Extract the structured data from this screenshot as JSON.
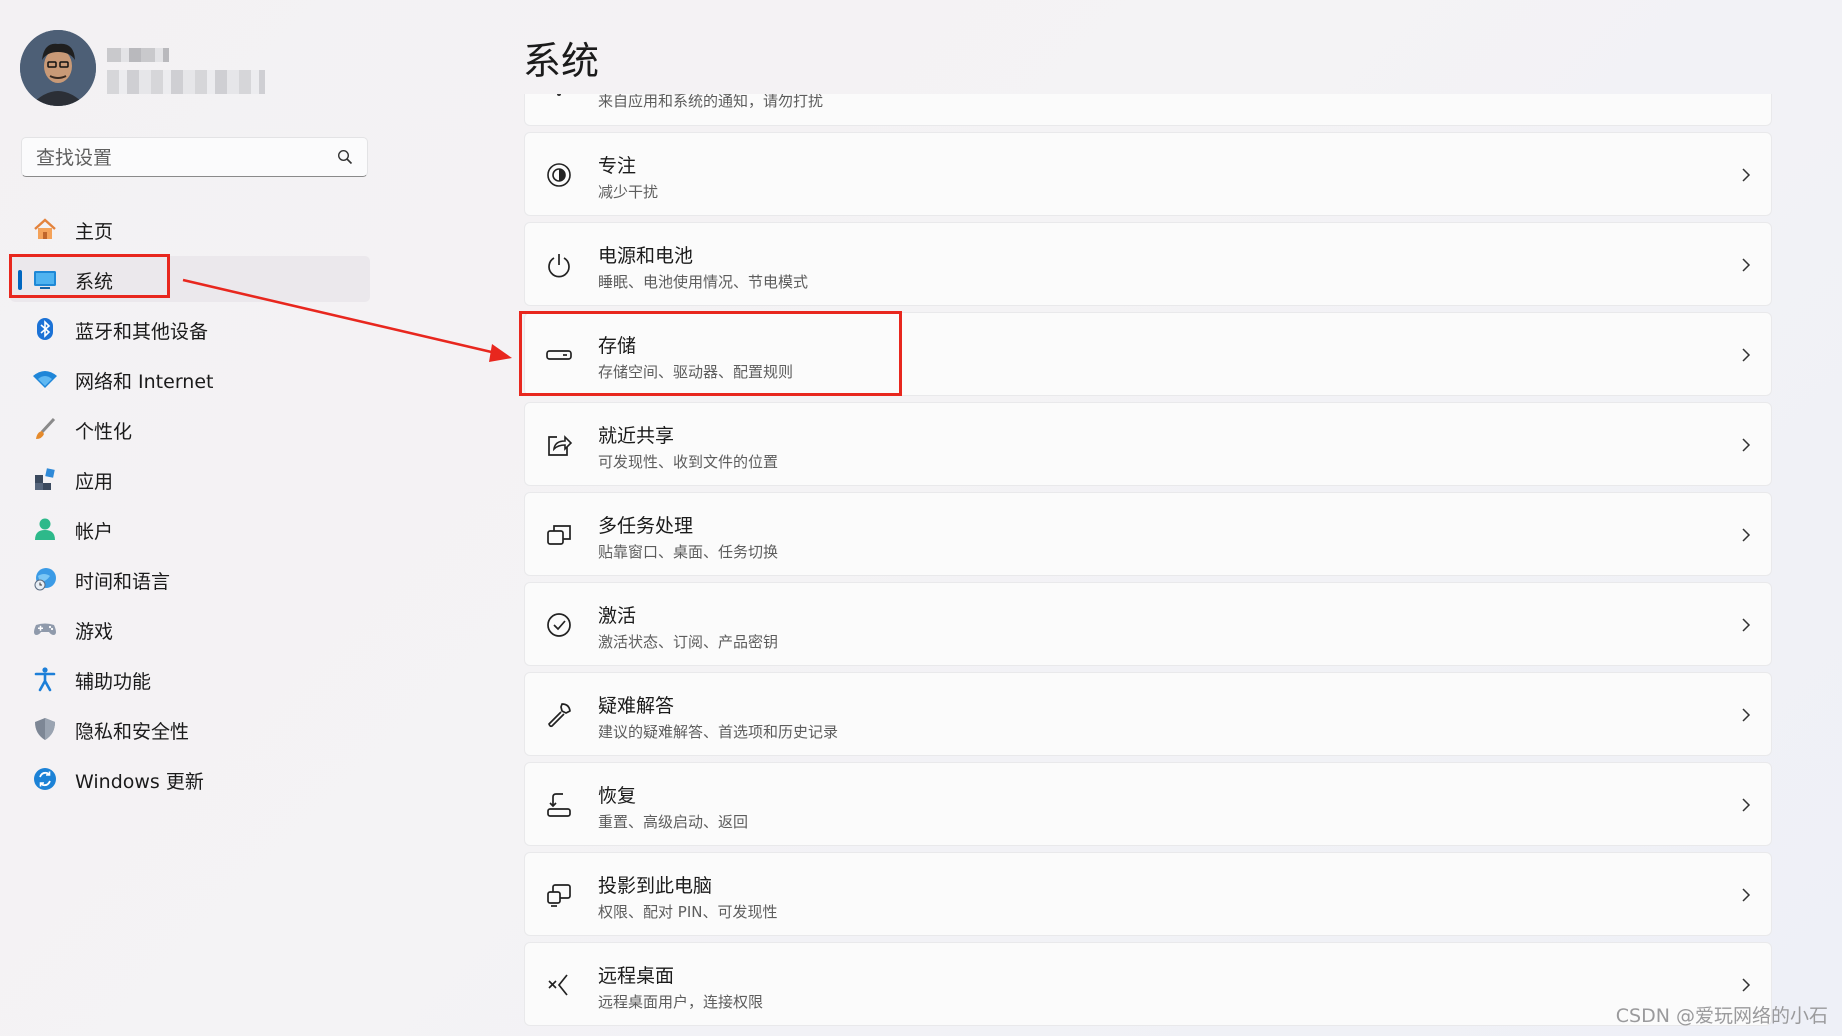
{
  "profile": {
    "avatar_icon": "user-avatar-icon"
  },
  "search": {
    "placeholder": "查找设置",
    "icon": "search-icon"
  },
  "sidebar": {
    "items": [
      {
        "label": "主页",
        "icon": "home-icon"
      },
      {
        "label": "系统",
        "icon": "system-display-icon",
        "active": true
      },
      {
        "label": "蓝牙和其他设备",
        "icon": "bluetooth-icon"
      },
      {
        "label": "网络和 Internet",
        "icon": "wifi-icon"
      },
      {
        "label": "个性化",
        "icon": "brush-icon"
      },
      {
        "label": "应用",
        "icon": "apps-icon"
      },
      {
        "label": "帐户",
        "icon": "account-icon"
      },
      {
        "label": "时间和语言",
        "icon": "time-language-icon"
      },
      {
        "label": "游戏",
        "icon": "gamepad-icon"
      },
      {
        "label": "辅助功能",
        "icon": "accessibility-icon"
      },
      {
        "label": "隐私和安全性",
        "icon": "shield-icon"
      },
      {
        "label": "Windows 更新",
        "icon": "update-icon"
      }
    ]
  },
  "main": {
    "title": "系统",
    "partial_card": {
      "subtitle": "来自应用和系统的通知，请勿打扰"
    },
    "cards": [
      {
        "title": "专注",
        "subtitle": "减少干扰",
        "icon": "focus-icon"
      },
      {
        "title": "电源和电池",
        "subtitle": "睡眠、电池使用情况、节电模式",
        "icon": "power-icon"
      },
      {
        "title": "存储",
        "subtitle": "存储空间、驱动器、配置规则",
        "icon": "storage-icon"
      },
      {
        "title": "就近共享",
        "subtitle": "可发现性、收到文件的位置",
        "icon": "share-icon"
      },
      {
        "title": "多任务处理",
        "subtitle": "贴靠窗口、桌面、任务切换",
        "icon": "multitask-icon"
      },
      {
        "title": "激活",
        "subtitle": "激活状态、订阅、产品密钥",
        "icon": "activation-icon"
      },
      {
        "title": "疑难解答",
        "subtitle": "建议的疑难解答、首选项和历史记录",
        "icon": "wrench-icon"
      },
      {
        "title": "恢复",
        "subtitle": "重置、高级启动、返回",
        "icon": "recovery-icon"
      },
      {
        "title": "投影到此电脑",
        "subtitle": "权限、配对 PIN、可发现性",
        "icon": "project-icon"
      },
      {
        "title": "远程桌面",
        "subtitle": "远程桌面用户，连接权限",
        "icon": "remote-desktop-icon"
      }
    ]
  },
  "annotation": {
    "color": "#e8271e"
  },
  "watermark": "CSDN @爱玩网络的小石"
}
